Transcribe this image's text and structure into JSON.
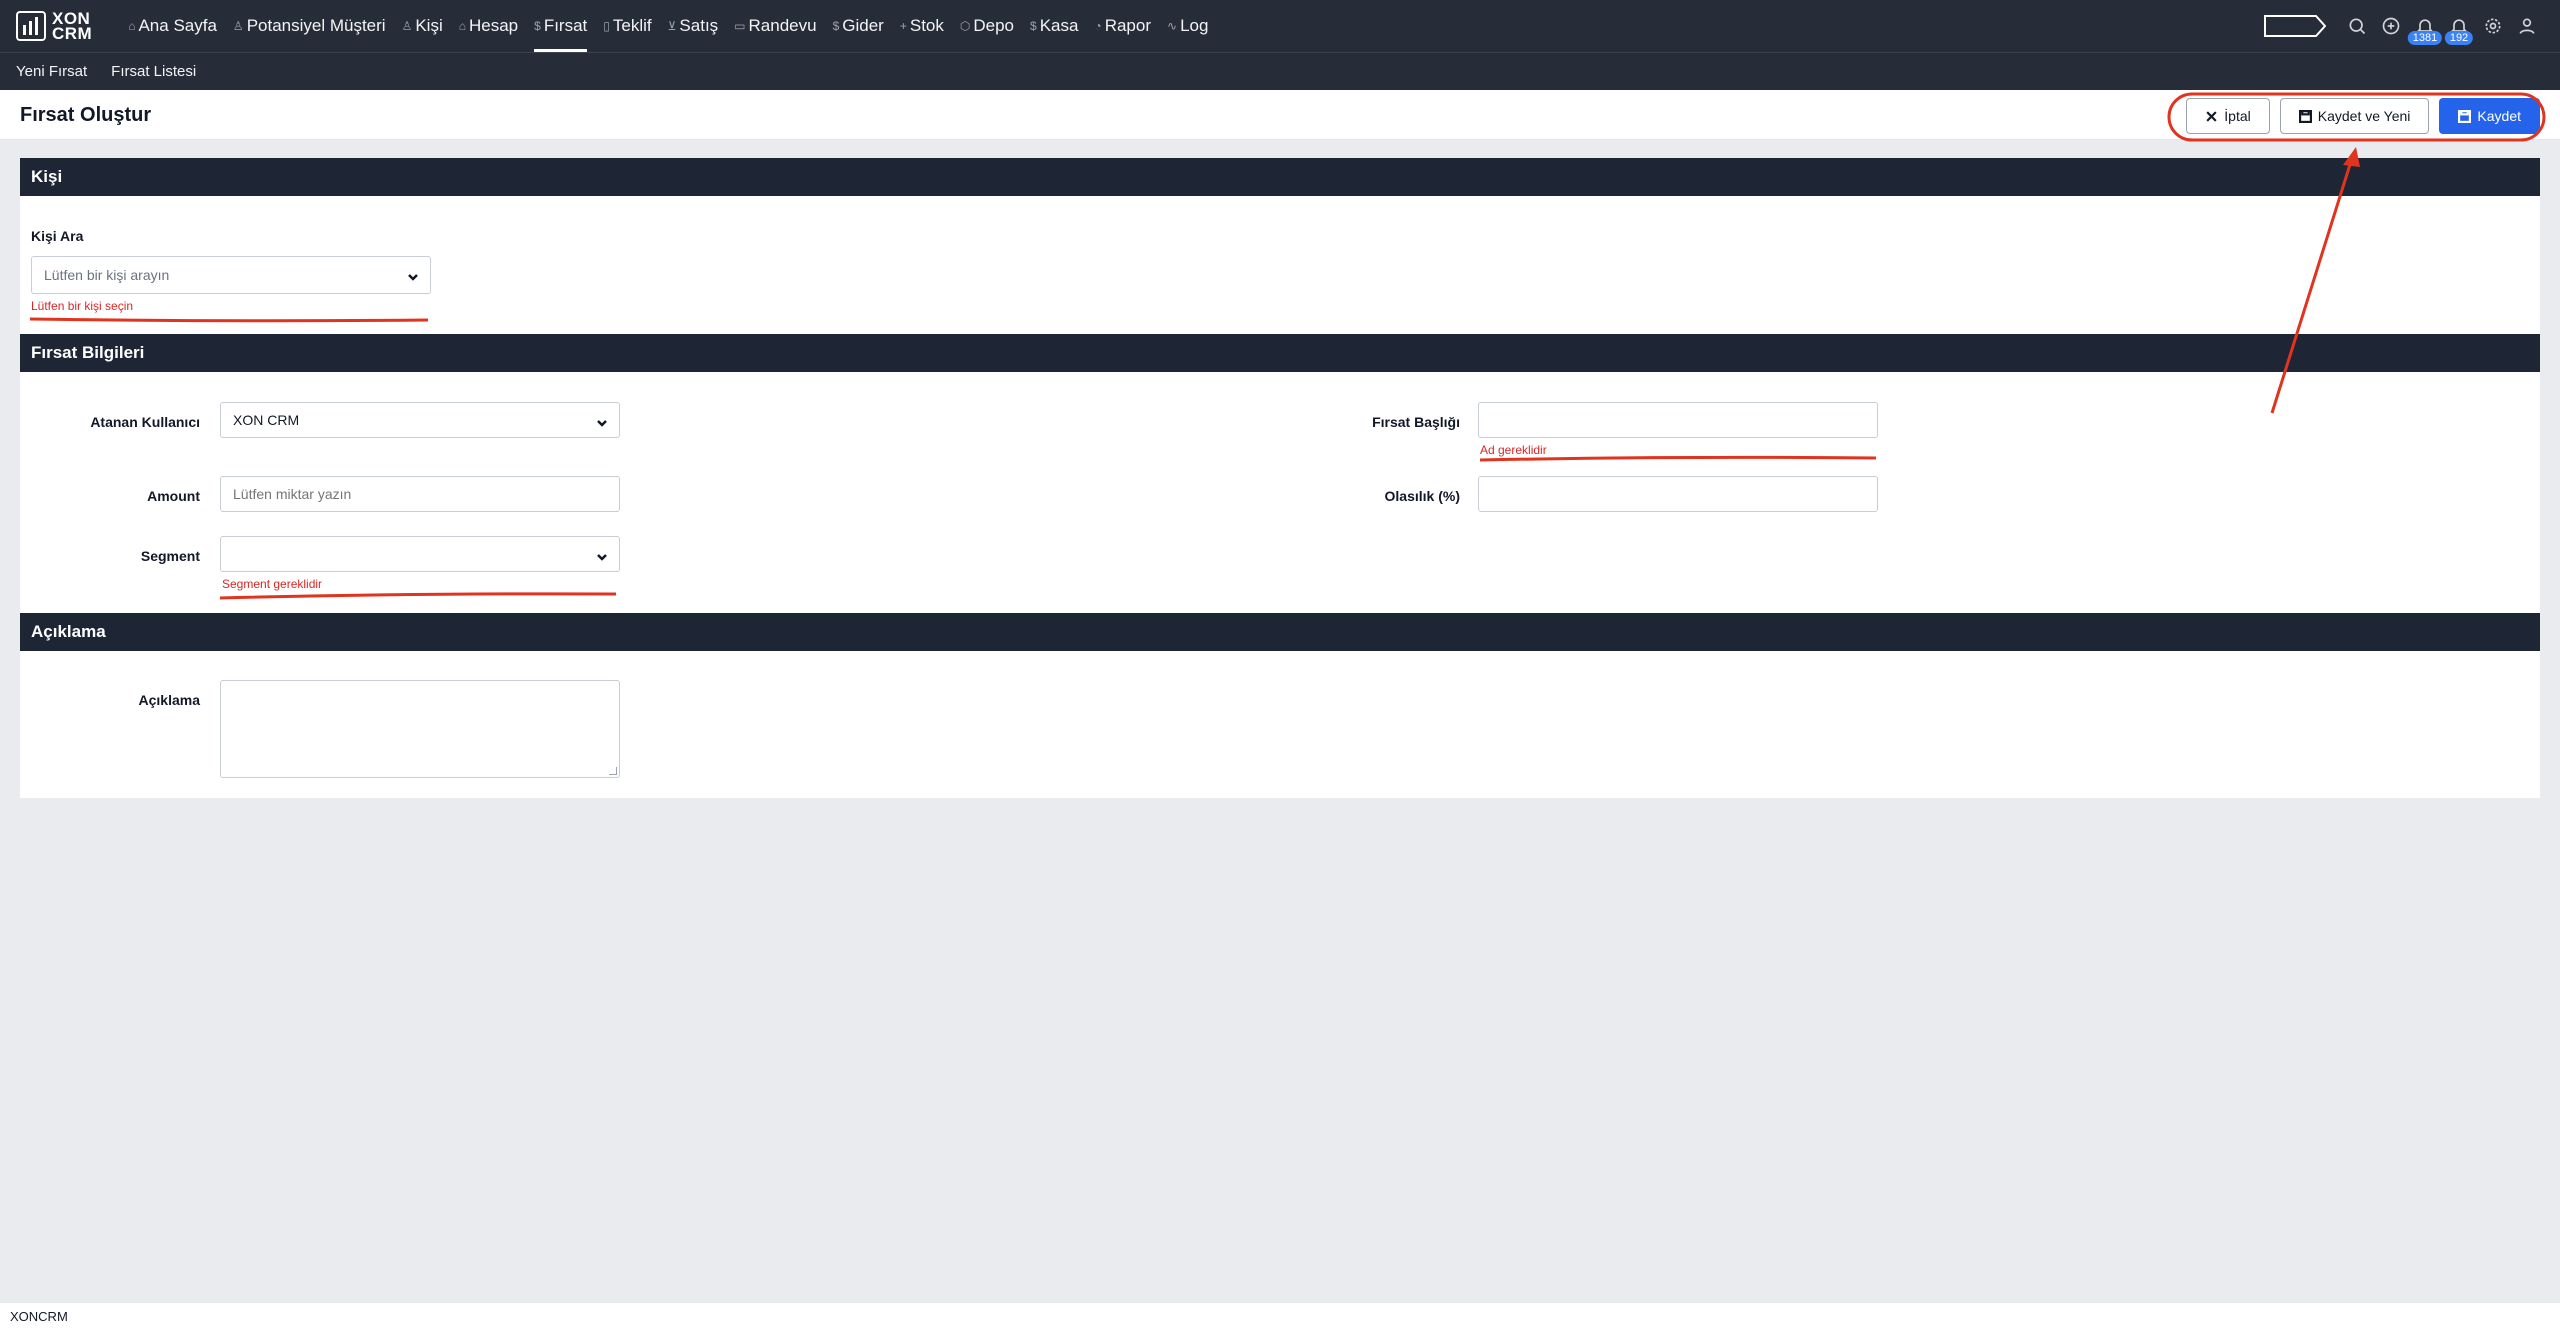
{
  "app": {
    "logo_line1": "XON",
    "logo_line2": "CRM"
  },
  "nav": {
    "items": [
      {
        "label": "Ana Sayfa",
        "icon": "home-icon",
        "glyph": "⌂"
      },
      {
        "label": "Potansiyel Müşteri",
        "icon": "user-icon",
        "glyph": "♙"
      },
      {
        "label": "Kişi",
        "icon": "users-icon",
        "glyph": "♙"
      },
      {
        "label": "Hesap",
        "icon": "building-icon",
        "glyph": "⌂"
      },
      {
        "label": "Fırsat",
        "icon": "dollar-icon",
        "glyph": "$"
      },
      {
        "label": "Teklif",
        "icon": "document-icon",
        "glyph": "▯"
      },
      {
        "label": "Satış",
        "icon": "cart-icon",
        "glyph": "⊻"
      },
      {
        "label": "Randevu",
        "icon": "calendar-icon",
        "glyph": "▭"
      },
      {
        "label": "Gider",
        "icon": "dollar-icon",
        "glyph": "$"
      },
      {
        "label": "Stok",
        "icon": "plus-icon",
        "glyph": "+"
      },
      {
        "label": "Depo",
        "icon": "box-icon",
        "glyph": "⬡"
      },
      {
        "label": "Kasa",
        "icon": "dollar-icon",
        "glyph": "$"
      },
      {
        "label": "Rapor",
        "icon": "pie-chart-icon",
        "glyph": "◔"
      },
      {
        "label": "Log",
        "icon": "activity-icon",
        "glyph": "∿"
      }
    ],
    "active": "Fırsat"
  },
  "top_right": {
    "notifications_1": "1381",
    "notifications_2": "192"
  },
  "subnav": {
    "new": "Yeni Fırsat",
    "list": "Fırsat Listesi"
  },
  "header": {
    "title": "Fırsat Oluştur",
    "cancel_label": "İptal",
    "save_new_label": "Kaydet ve Yeni",
    "save_label": "Kaydet"
  },
  "person": {
    "section_title": "Kişi",
    "search_label": "Kişi Ara",
    "search_placeholder": "Lütfen bir kişi arayın",
    "search_error": "Lütfen bir kişi seçin"
  },
  "opportunity": {
    "section_title": "Fırsat Bilgileri",
    "assigned_label": "Atanan Kullanıcı",
    "assigned_value": "XON CRM",
    "amount_label": "Amount",
    "amount_placeholder": "Lütfen miktar yazın",
    "segment_label": "Segment",
    "segment_value": "",
    "segment_error": "Segment gereklidir",
    "title_label": "Fırsat Başlığı",
    "title_value": "",
    "title_error": "Ad gereklidir",
    "probability_label": "Olasılık (%)",
    "probability_value": ""
  },
  "description": {
    "section_title": "Açıklama",
    "label": "Açıklama"
  },
  "footer": {
    "text": "XONCRM"
  },
  "colors": {
    "nav_bg": "#262c38",
    "section_bg": "#1e2535",
    "primary": "#2563eb",
    "error": "#dc2626",
    "annotation": "#e0341e"
  }
}
